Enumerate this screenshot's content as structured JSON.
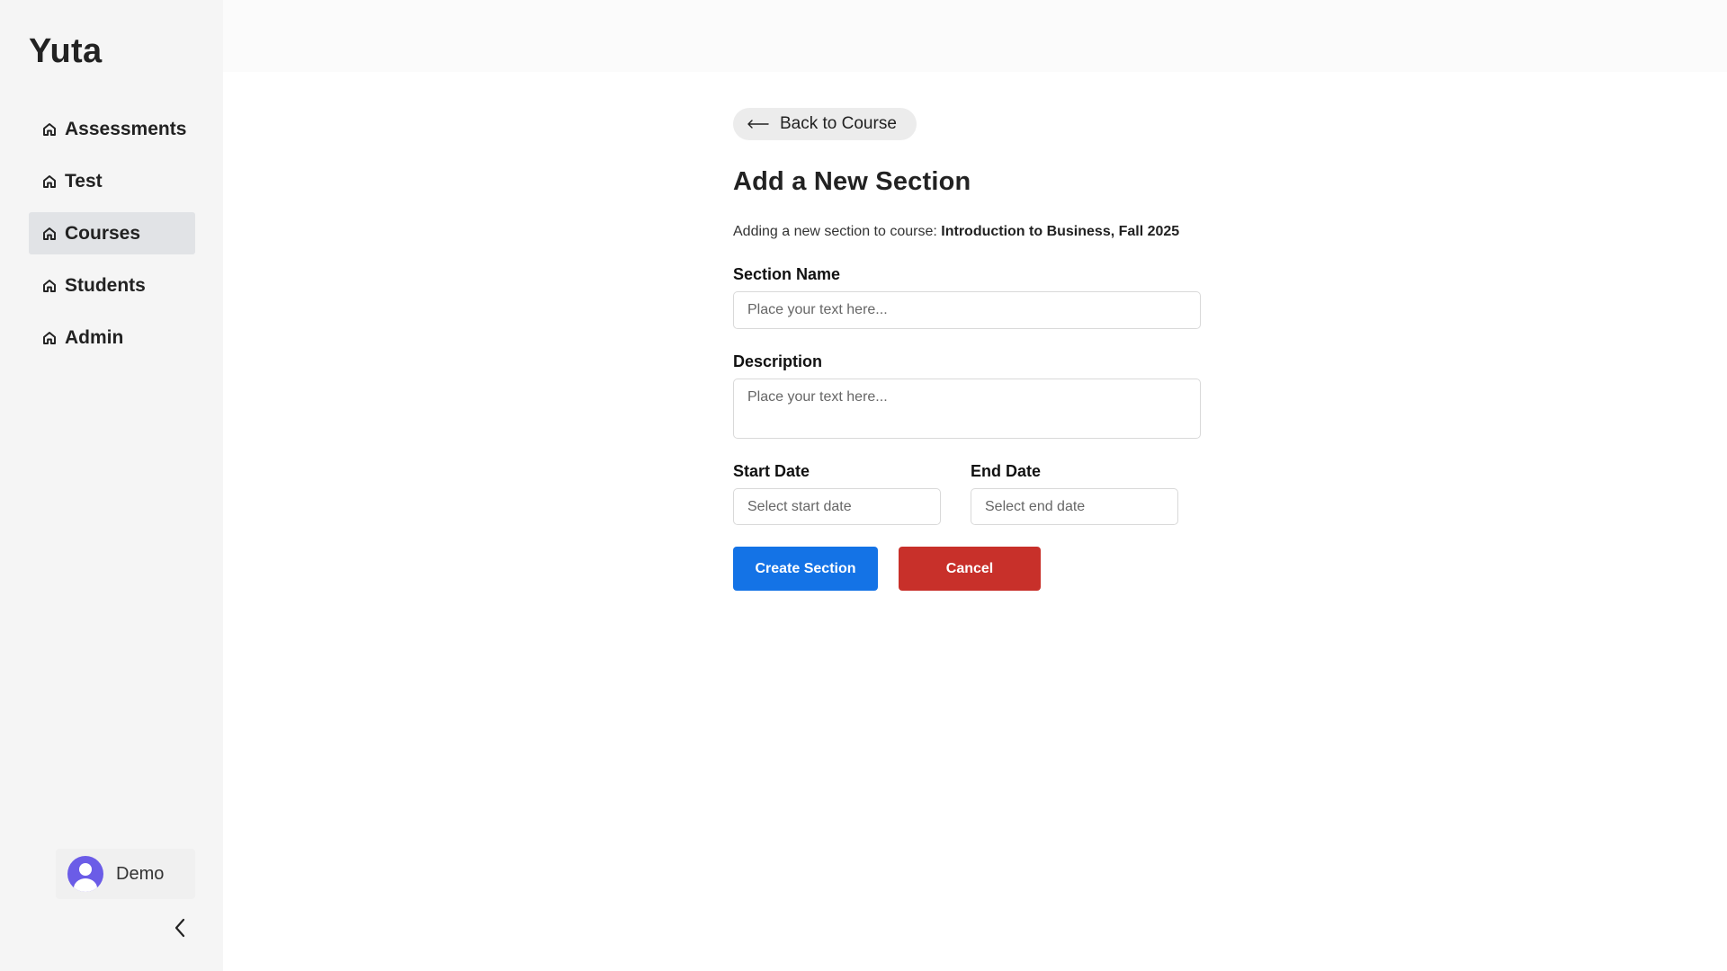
{
  "app": {
    "brand": "Yuta"
  },
  "sidebar": {
    "items": [
      {
        "label": "Assessments",
        "icon": "home-icon",
        "active": false
      },
      {
        "label": "Test",
        "icon": "home-icon",
        "active": false
      },
      {
        "label": "Courses",
        "icon": "home-icon",
        "active": true
      },
      {
        "label": "Students",
        "icon": "home-icon",
        "active": false
      },
      {
        "label": "Admin",
        "icon": "home-icon",
        "active": false
      }
    ],
    "user": {
      "name": "Demo",
      "avatar_color": "#6b5ce7"
    },
    "collapse_icon": "chevron-left-icon"
  },
  "page": {
    "back_label": "Back to Course",
    "title": "Add a New Section",
    "subtitle_prefix": "Adding a new section to course:",
    "course_name": "Introduction to Business, Fall 2025"
  },
  "form": {
    "section_name": {
      "label": "Section Name",
      "placeholder": "Place your text here...",
      "value": ""
    },
    "description": {
      "label": "Description",
      "placeholder": "Place your text here...",
      "value": ""
    },
    "start_date": {
      "label": "Start Date",
      "placeholder": "Select start date",
      "value": ""
    },
    "end_date": {
      "label": "End Date",
      "placeholder": "Select end date",
      "value": ""
    },
    "submit_label": "Create Section",
    "cancel_label": "Cancel"
  },
  "colors": {
    "primary": "#1473e6",
    "danger": "#c8302a",
    "sidebar_bg": "#f5f5f5",
    "active_item_bg": "#e1e3e6"
  }
}
